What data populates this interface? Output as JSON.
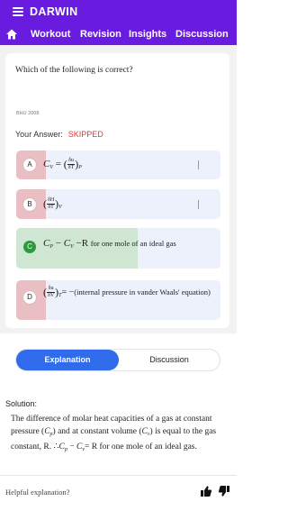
{
  "app": {
    "title": "DARWIN"
  },
  "nav": {
    "items": [
      "Workout",
      "Revision",
      "Insights",
      "Discussion"
    ]
  },
  "question": {
    "text": "Which of the following is correct?",
    "source": "BHU 2008",
    "your_answer_label": "Your Answer:",
    "your_answer_status": "SKIPPED"
  },
  "options": [
    {
      "letter": "A",
      "lhs": "C",
      "lhs_sub": "V",
      "num": "δu",
      "den": "δT",
      "outer_sub": "P",
      "state": "wrong"
    },
    {
      "letter": "B",
      "num": "δH",
      "den": "δT",
      "outer_sub": "V",
      "state": "wrong"
    },
    {
      "letter": "C",
      "formula": "C",
      "note": "for one mole of an ideal gas",
      "state": "correct"
    },
    {
      "letter": "D",
      "num": "δu",
      "den": "δV",
      "outer_sub": "T",
      "note": "(internal pressure in vander Waals' equation)",
      "state": "wrong"
    }
  ],
  "tabs": {
    "explanation": "Explanation",
    "discussion": "Discussion"
  },
  "solution": {
    "label": "Solution:",
    "text_1": "The difference of molar heat capacities of a gas at constant pressure",
    "text_2": "and at constant volume",
    "text_3": "is equal to the gas constant, R.",
    "text_4": "R for one mole of an ideal gas."
  },
  "feedback": {
    "label": "Helpful explanation?"
  },
  "colors": {
    "brand": "#6a1be0",
    "accent": "#2f6bea",
    "correct": "#2f9a3d",
    "skipped": "#e53935"
  }
}
